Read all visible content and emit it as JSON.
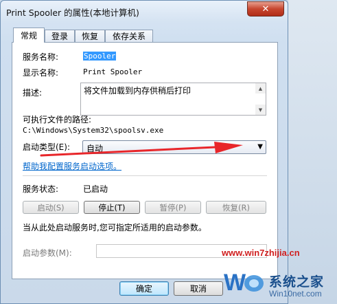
{
  "window": {
    "title": "Print Spooler 的属性(本地计算机)",
    "close_glyph": "✕"
  },
  "tabs": [
    {
      "label": "常规",
      "active": true
    },
    {
      "label": "登录",
      "active": false
    },
    {
      "label": "恢复",
      "active": false
    },
    {
      "label": "依存关系",
      "active": false
    }
  ],
  "general": {
    "service_name_label": "服务名称:",
    "service_name_value": "Spooler",
    "display_name_label": "显示名称:",
    "display_name_value": "Print Spooler",
    "description_label": "描述:",
    "description_value": "将文件加载到内存供稍后打印",
    "exe_path_label": "可执行文件的路径:",
    "exe_path_value": "C:\\Windows\\System32\\spoolsv.exe",
    "startup_type_label": "启动类型(E):",
    "startup_type_value": "自动",
    "help_link": "帮助我配置服务启动选项。",
    "status_label": "服务状态:",
    "status_value": "已启动",
    "buttons": {
      "start": "启动(S)",
      "stop": "停止(T)",
      "pause": "暂停(P)",
      "resume": "恢复(R)"
    },
    "hint": "当从此处启动服务时,您可指定所适用的启动参数。",
    "params_label": "启动参数(M):",
    "params_value": ""
  },
  "dialog_buttons": {
    "ok": "确定",
    "cancel": "取消"
  },
  "watermark": {
    "url": "www.win7zhijia.cn",
    "name": "系统之家",
    "domain": "Win10net.com"
  },
  "colors": {
    "annotation_arrow": "#e8262a",
    "selection": "#3399ff",
    "link": "#0066cc"
  }
}
